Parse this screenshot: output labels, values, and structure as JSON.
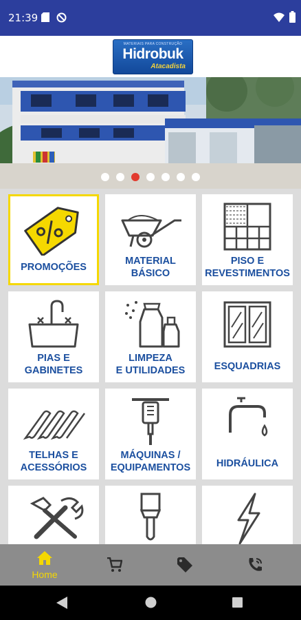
{
  "statusbar": {
    "time": "21:39",
    "icons": [
      "sd-card-icon",
      "sync-icon",
      "wifi-icon",
      "battery-icon"
    ]
  },
  "header": {
    "logo_tagline": "MATERIAIS PARA CONSTRUÇÃO",
    "logo_brand": "Hidrobuk",
    "logo_sub": "Atacadista"
  },
  "banner": {
    "slide_count": 7,
    "active_index": 2
  },
  "categories": [
    {
      "label_1": "PROMOÇÕES",
      "label_2": "",
      "icon": "discount-tag-icon",
      "selected": true
    },
    {
      "label_1": "MATERIAL",
      "label_2": "BÁSICO",
      "icon": "wheelbarrow-icon"
    },
    {
      "label_1": "PISO E",
      "label_2": "REVESTIMENTOS",
      "icon": "tiles-icon"
    },
    {
      "label_1": "PIAS E",
      "label_2": "GABINETES",
      "icon": "sink-icon"
    },
    {
      "label_1": "LIMPEZA",
      "label_2": "E UTILIDADES",
      "icon": "cleaning-spray-icon"
    },
    {
      "label_1": "ESQUADRIAS",
      "label_2": "",
      "icon": "window-icon"
    },
    {
      "label_1": "TELHAS E",
      "label_2": "ACESSÓRIOS",
      "icon": "roof-tiles-icon"
    },
    {
      "label_1": "MÁQUINAS /",
      "label_2": "EQUIPAMENTOS",
      "icon": "jackhammer-icon"
    },
    {
      "label_1": "HIDRÁULICA",
      "label_2": "",
      "icon": "faucet-icon"
    },
    {
      "label_1": "",
      "label_2": "",
      "icon": "tools-icon"
    },
    {
      "label_1": "",
      "label_2": "",
      "icon": "paint-brush-icon"
    },
    {
      "label_1": "",
      "label_2": "",
      "icon": "lightning-icon"
    }
  ],
  "bottom_nav": {
    "home_label": "Home",
    "items": [
      "home-icon",
      "cart-icon",
      "tag-icon",
      "phone-icon"
    ]
  },
  "colors": {
    "status_bar": "#2c3e9d",
    "label_blue": "#1b4f9f",
    "accent_yellow": "#f5d800",
    "nav_bg": "#8c8c8c"
  }
}
